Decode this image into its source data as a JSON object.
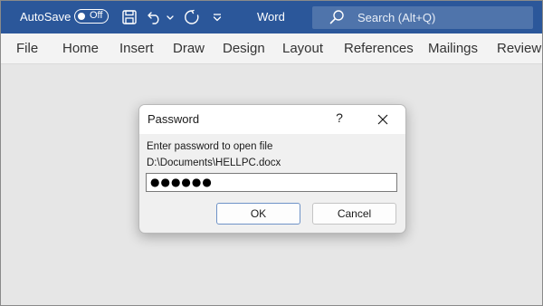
{
  "titlebar": {
    "autosave_label": "AutoSave",
    "autosave_toggle": "Off",
    "app_name": "Word",
    "search_placeholder": "Search (Alt+Q)",
    "accent_color": "#2b579a",
    "icons": [
      "save-icon",
      "undo-icon",
      "undo-dropdown-icon",
      "redo-icon",
      "customize-qat-icon",
      "search-icon"
    ]
  },
  "ribbon": {
    "tabs": [
      "File",
      "Home",
      "Insert",
      "Draw",
      "Design",
      "Layout",
      "References",
      "Mailings",
      "Review"
    ]
  },
  "dialog": {
    "title": "Password",
    "help": "?",
    "prompt": "Enter password to open file",
    "file_path": "D:\\Documents\\HELLPC.docx",
    "password_mask": "●●●●●●",
    "ok_label": "OK",
    "cancel_label": "Cancel"
  }
}
